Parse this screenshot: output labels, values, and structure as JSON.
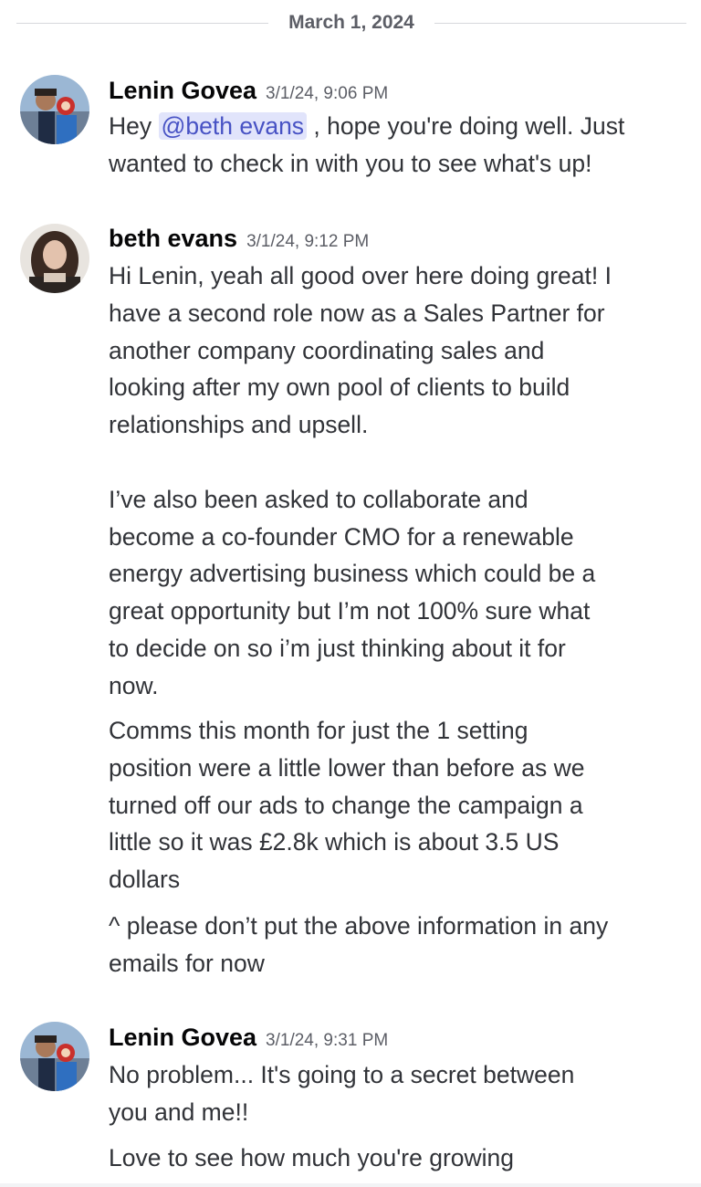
{
  "date_divider": "March 1, 2024",
  "messages": [
    {
      "author": "Lenin Govea",
      "timestamp": "3/1/24, 9:06 PM",
      "mention": "@beth evans",
      "text_before": "Hey ",
      "text_after_line1": " , hope you're doing well. Just",
      "text_line2": "wanted to check in with you to see what's up!"
    },
    {
      "author": "beth evans",
      "timestamp": "3/1/24, 9:12 PM",
      "paragraph1": [
        "Hi Lenin, yeah all good over here doing great! I",
        "have a second role now as a Sales Partner for",
        "another company coordinating sales and",
        "looking after my own pool of clients to build",
        "relationships and upsell."
      ],
      "paragraph2": [
        "I’ve also been asked to collaborate and",
        "become a co-founder CMO for a renewable",
        "energy advertising business which could be a",
        "great opportunity but I’m not 100% sure what",
        "to decide on so i’m just thinking about it for",
        "now."
      ],
      "paragraph3": [
        "Comms this month for just the 1 setting",
        "position were a little lower than before as we",
        "turned off our ads to change the campaign a",
        "little so it was £2.8k which is about 3.5 US",
        "dollars"
      ],
      "paragraph4": [
        "^ please don’t put the above information in any",
        "emails for now"
      ]
    },
    {
      "author": "Lenin Govea",
      "timestamp": "3/1/24, 9:31 PM",
      "paragraph1": [
        "No problem... It's going to a secret between",
        "you and me!!"
      ],
      "paragraph2": [
        "Love to see how much you're growing"
      ]
    }
  ]
}
